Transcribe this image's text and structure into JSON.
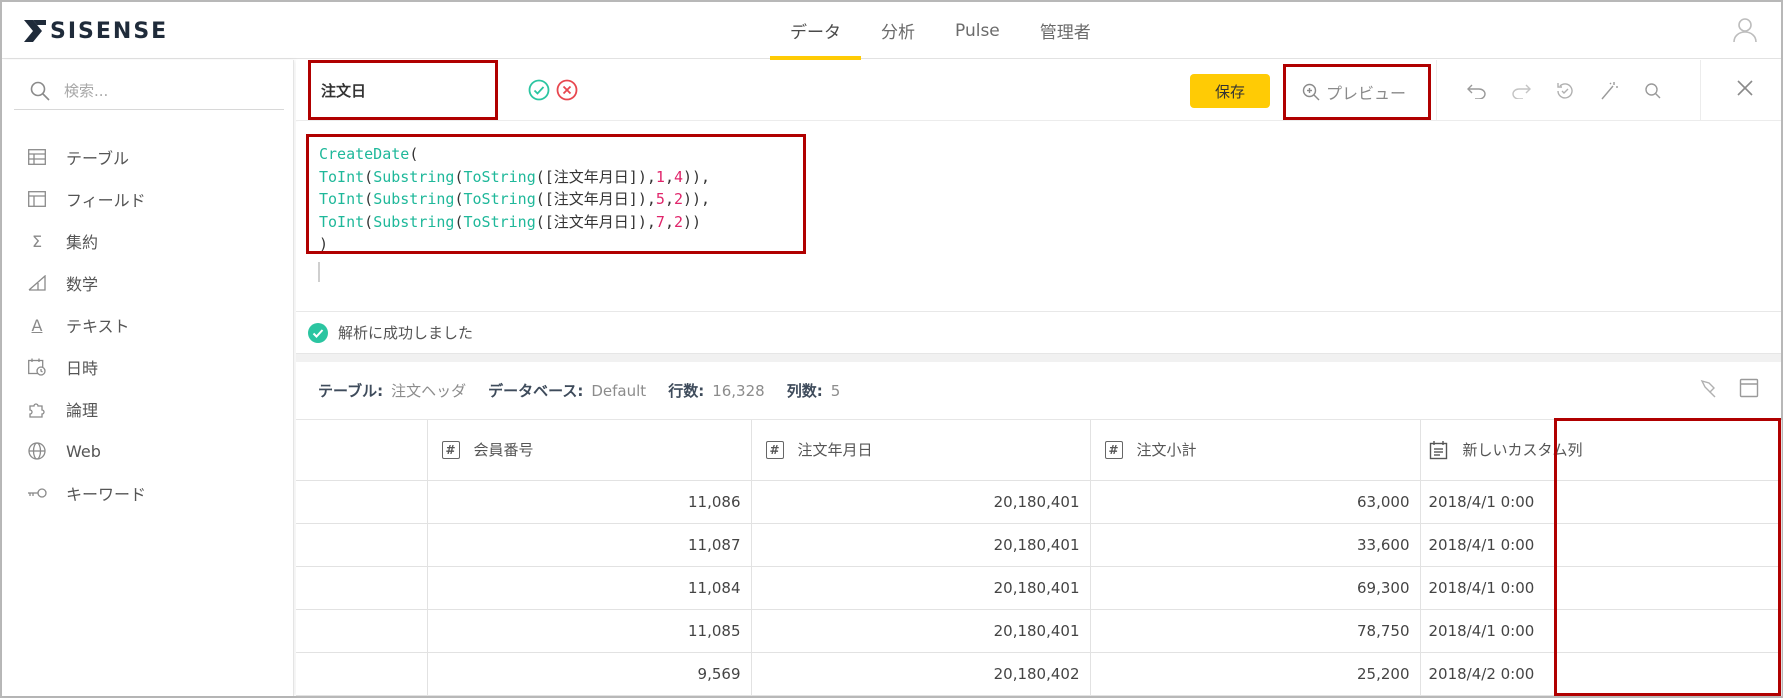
{
  "app": {
    "brand": "SISENSE"
  },
  "nav": {
    "tabs": [
      "データ",
      "分析",
      "Pulse",
      "管理者"
    ],
    "active_index": 0
  },
  "sidebar": {
    "search_placeholder": "検索...",
    "items": [
      {
        "label": "テーブル",
        "icon": "table-icon"
      },
      {
        "label": "フィールド",
        "icon": "field-icon"
      },
      {
        "label": "集約",
        "icon": "sigma-icon"
      },
      {
        "label": "数学",
        "icon": "math-icon"
      },
      {
        "label": "テキスト",
        "icon": "text-icon"
      },
      {
        "label": "日時",
        "icon": "calendar-icon"
      },
      {
        "label": "論理",
        "icon": "puzzle-icon"
      },
      {
        "label": "Web",
        "icon": "globe-icon"
      },
      {
        "label": "キーワード",
        "icon": "key-icon"
      }
    ]
  },
  "formula": {
    "name": "注文日",
    "save_label": "保存",
    "preview_label": "プレビュー",
    "code": [
      [
        {
          "t": "CreateDate",
          "c": "fn"
        },
        {
          "t": "(",
          "c": ""
        }
      ],
      [
        {
          "t": "ToInt",
          "c": "fn"
        },
        {
          "t": "(",
          "c": ""
        },
        {
          "t": "Substring",
          "c": "fn"
        },
        {
          "t": "(",
          "c": ""
        },
        {
          "t": "ToString",
          "c": "fn"
        },
        {
          "t": "([注文年月日]),",
          "c": ""
        },
        {
          "t": "1",
          "c": "num"
        },
        {
          "t": ",",
          "c": ""
        },
        {
          "t": "4",
          "c": "num"
        },
        {
          "t": ")),",
          "c": ""
        }
      ],
      [
        {
          "t": "ToInt",
          "c": "fn"
        },
        {
          "t": "(",
          "c": ""
        },
        {
          "t": "Substring",
          "c": "fn"
        },
        {
          "t": "(",
          "c": ""
        },
        {
          "t": "ToString",
          "c": "fn"
        },
        {
          "t": "([注文年月日]),",
          "c": ""
        },
        {
          "t": "5",
          "c": "num"
        },
        {
          "t": ",",
          "c": ""
        },
        {
          "t": "2",
          "c": "num"
        },
        {
          "t": ")),",
          "c": ""
        }
      ],
      [
        {
          "t": "ToInt",
          "c": "fn"
        },
        {
          "t": "(",
          "c": ""
        },
        {
          "t": "Substring",
          "c": "fn"
        },
        {
          "t": "(",
          "c": ""
        },
        {
          "t": "ToString",
          "c": "fn"
        },
        {
          "t": "([注文年月日]),",
          "c": ""
        },
        {
          "t": "7",
          "c": "num"
        },
        {
          "t": ",",
          "c": ""
        },
        {
          "t": "2",
          "c": "num"
        },
        {
          "t": "))",
          "c": ""
        }
      ],
      [
        {
          "t": ")",
          "c": ""
        }
      ]
    ],
    "status": "解析に成功しました"
  },
  "info": {
    "table_label": "テーブル:",
    "table_value": "注文ヘッダ",
    "db_label": "データベース:",
    "db_value": "Default",
    "rows_label": "行数:",
    "rows_value": "16,328",
    "cols_label": "列数:",
    "cols_value": "5"
  },
  "grid": {
    "columns": [
      "",
      "会員番号",
      "注文年月日",
      "注文小計",
      "新しいカスタム列"
    ],
    "rows": [
      [
        "",
        "11,086",
        "20,180,401",
        "63,000",
        "2018/4/1 0:00"
      ],
      [
        "",
        "11,087",
        "20,180,401",
        "33,600",
        "2018/4/1 0:00"
      ],
      [
        "",
        "11,084",
        "20,180,401",
        "69,300",
        "2018/4/1 0:00"
      ],
      [
        "",
        "11,085",
        "20,180,401",
        "78,750",
        "2018/4/1 0:00"
      ],
      [
        "",
        "9,569",
        "20,180,402",
        "25,200",
        "2018/4/2 0:00"
      ]
    ]
  },
  "colors": {
    "accent": "#ffcb05",
    "highlight": "#b00000",
    "code_function": "#1fb89a",
    "code_number": "#e0246a",
    "ok_green": "#2bc5a1",
    "cancel_red": "#e8474f"
  }
}
